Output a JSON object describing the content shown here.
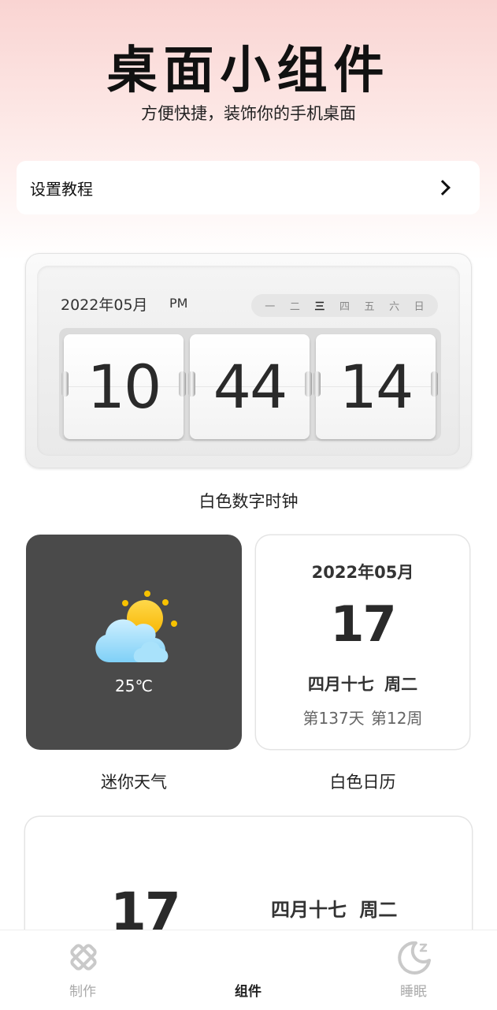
{
  "header": {
    "title": "桌面小组件",
    "subtitle": "方便快捷，装饰你的手机桌面"
  },
  "tutorial": {
    "label": "设置教程",
    "icon": "chevron-right-icon"
  },
  "flip_clock": {
    "date": "2022年05月",
    "ampm": "PM",
    "weekdays": [
      "一",
      "二",
      "三",
      "四",
      "五",
      "六",
      "日"
    ],
    "active_weekday": "三",
    "hours": "10",
    "minutes": "44",
    "seconds": "14",
    "caption": "白色数字时钟"
  },
  "weather_widget": {
    "icon": "partly-cloudy-icon",
    "temperature": "25℃",
    "caption": "迷你天气",
    "background": "#4a4a4a"
  },
  "calendar_widget": {
    "year_month": "2022年05月",
    "day": "17",
    "lunar": "四月十七  周二",
    "info": "第137天 第12周",
    "caption": "白色日历"
  },
  "partial_widget": {
    "day": "17",
    "lunar": "四月十七  周二"
  },
  "tabbar": {
    "tabs": [
      {
        "label": "制作",
        "icon": "make-tool-icon",
        "active": false
      },
      {
        "label": "组件",
        "icon": "",
        "active": true
      },
      {
        "label": "睡眠",
        "icon": "moon-sleep-icon",
        "active": false
      }
    ]
  }
}
